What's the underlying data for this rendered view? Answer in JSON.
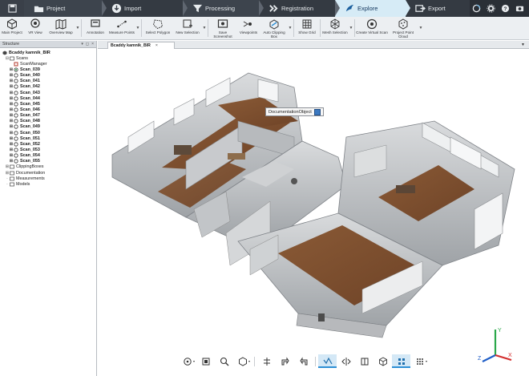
{
  "workflow_tabs": [
    {
      "label": "Project"
    },
    {
      "label": "Import"
    },
    {
      "label": "Processing"
    },
    {
      "label": "Registration"
    },
    {
      "label": "Explore",
      "active": true
    },
    {
      "label": "Export"
    }
  ],
  "ribbon": {
    "items": [
      {
        "label": "Main Project"
      },
      {
        "label": "VR View"
      },
      {
        "label": "Overview Map"
      },
      {
        "label": "Annotation"
      },
      {
        "label": "Measure Points"
      },
      {
        "label": "Select Polygon"
      },
      {
        "label": "New Selection"
      },
      {
        "label": "Save Screenshot"
      },
      {
        "label": "Viewpoints"
      },
      {
        "label": "Auto Clipping Box"
      },
      {
        "label": "Show Grid"
      },
      {
        "label": "Mesh Selection"
      },
      {
        "label": "Create Virtual Scan"
      },
      {
        "label": "Project Point Cloud"
      }
    ]
  },
  "structure": {
    "title": "Structure",
    "root": "Bcaddy kamnik_BIR",
    "scans_label": "Scans",
    "scan_manager": "ScanManager",
    "scans": [
      "Scan_039",
      "Scan_040",
      "Scan_041",
      "Scan_042",
      "Scan_043",
      "Scan_044",
      "Scan_045",
      "Scan_046",
      "Scan_047",
      "Scan_048",
      "Scan_049",
      "Scan_050",
      "Scan_051",
      "Scan_052",
      "Scan_053",
      "Scan_054",
      "Scan_055"
    ],
    "other_folders": [
      "ClippingBoxes",
      "Documentation",
      "Measurements",
      "Models"
    ]
  },
  "document_tab": {
    "label": "Bcaddy kamnik_BIR",
    "close": "×"
  },
  "tooltip": {
    "label": "DocumentationObject"
  },
  "view_toolbar": {
    "items": [
      "view-mode",
      "viewpoint",
      "zoom",
      "display-mode",
      "clipping-plane",
      "measure-a",
      "measure-b",
      "point-cloud-view",
      "mirror",
      "split-view",
      "cube",
      "grid-points",
      "more"
    ]
  },
  "axes": {
    "x": "X",
    "y": "Y",
    "z": "Z"
  },
  "colors": {
    "accent": "#2d8fd5",
    "explore_tab": "#d6ebf6",
    "topbar": "#2a2f36"
  }
}
